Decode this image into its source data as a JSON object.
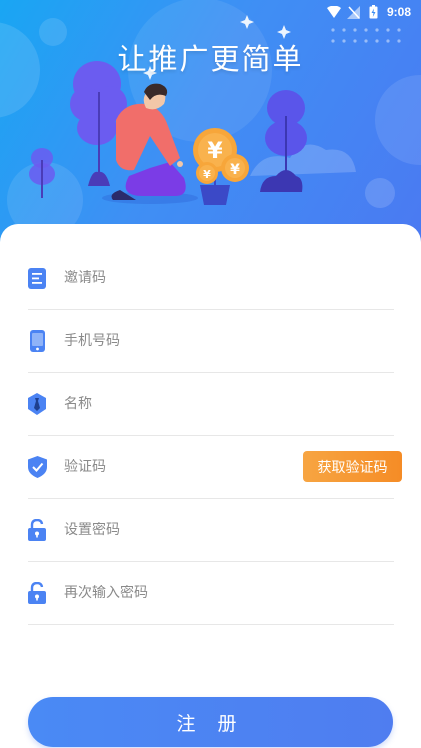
{
  "status": {
    "time": "9:08"
  },
  "hero": {
    "title": "让推广更简单"
  },
  "form": {
    "invite_placeholder": "邀请码",
    "phone_placeholder": "手机号码",
    "name_placeholder": "名称",
    "code_placeholder": "验证码",
    "get_code_label": "获取验证码",
    "password_placeholder": "设置密码",
    "confirm_password_placeholder": "再次输入密码",
    "register_label": "注 册"
  },
  "icons": {
    "invite": "document-icon",
    "phone": "phone-icon",
    "name": "tie-icon",
    "code": "shield-check-icon",
    "password": "unlock-icon",
    "confirm_password": "unlock-icon"
  },
  "colors": {
    "accent": "#4b7ff2",
    "orange": "#f5962e",
    "divider": "#e7e7e7"
  }
}
